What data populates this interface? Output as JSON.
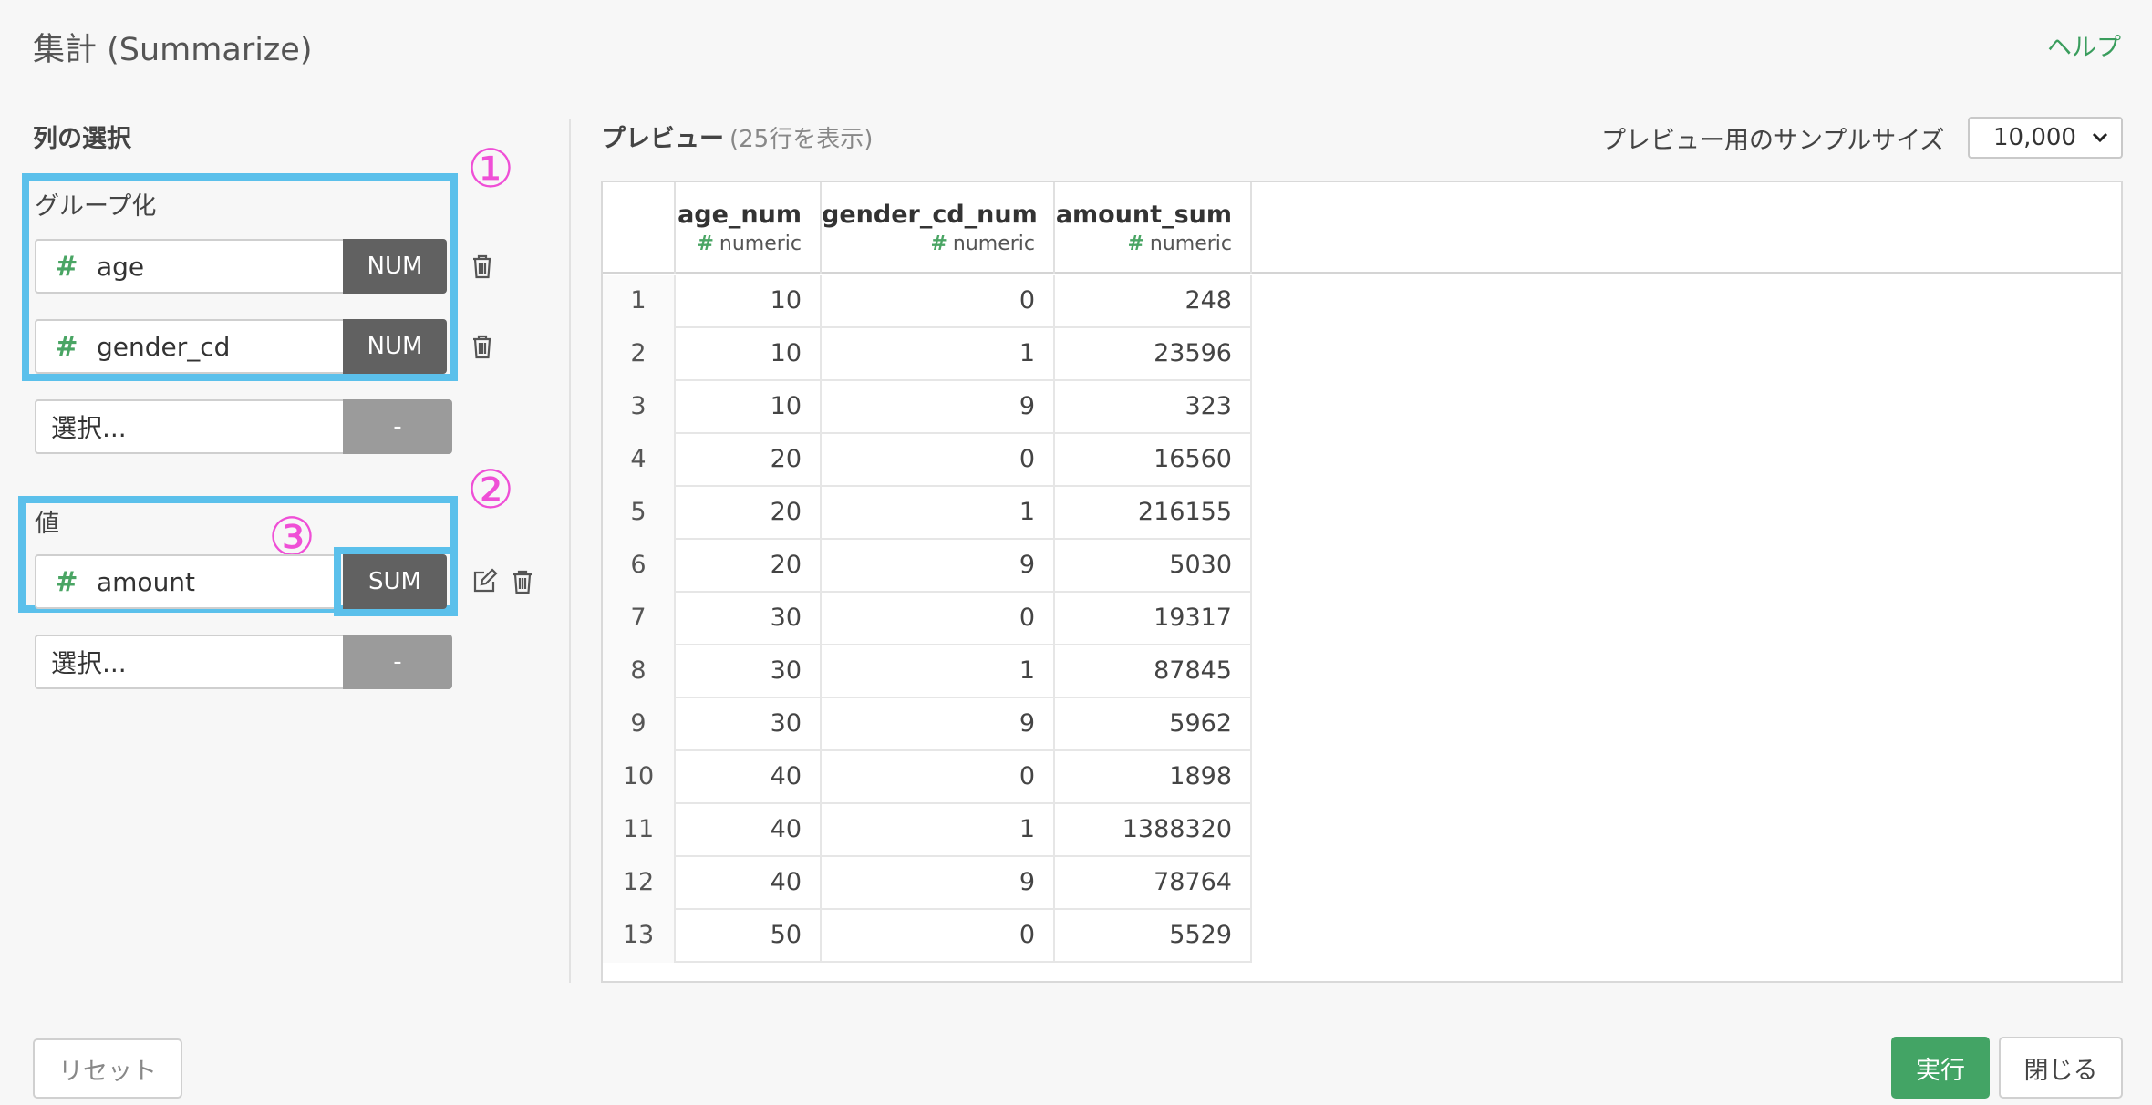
{
  "dialog": {
    "title": "集計 (Summarize)",
    "help_link": "ヘルプ"
  },
  "left_panel": {
    "heading": "列の選択",
    "group_by": {
      "label": "グループ化",
      "items": [
        {
          "icon": "hash-icon",
          "name": "age",
          "type": "NUM"
        },
        {
          "icon": "hash-icon",
          "name": "gender_cd",
          "type": "NUM"
        }
      ],
      "select_placeholder": "選択...",
      "select_type": "-"
    },
    "values": {
      "label": "値",
      "items": [
        {
          "icon": "hash-icon",
          "name": "amount",
          "agg": "SUM"
        }
      ],
      "select_placeholder": "選択...",
      "select_type": "-"
    },
    "annotations": [
      "①",
      "②",
      "③"
    ]
  },
  "preview": {
    "title": "プレビュー",
    "row_count_text": "(25行を表示)",
    "sample_size_label": "プレビュー用のサンプルサイズ",
    "sample_size_value": "10,000",
    "columns": [
      {
        "name": "age_num",
        "type": "numeric"
      },
      {
        "name": "gender_cd_num",
        "type": "numeric"
      },
      {
        "name": "amount_sum",
        "type": "numeric"
      }
    ],
    "type_icon": "#",
    "rows": [
      [
        "1",
        "10",
        "0",
        "248"
      ],
      [
        "2",
        "10",
        "1",
        "23596"
      ],
      [
        "3",
        "10",
        "9",
        "323"
      ],
      [
        "4",
        "20",
        "0",
        "16560"
      ],
      [
        "5",
        "20",
        "1",
        "216155"
      ],
      [
        "6",
        "20",
        "9",
        "5030"
      ],
      [
        "7",
        "30",
        "0",
        "19317"
      ],
      [
        "8",
        "30",
        "1",
        "87845"
      ],
      [
        "9",
        "30",
        "9",
        "5962"
      ],
      [
        "10",
        "40",
        "0",
        "1898"
      ],
      [
        "11",
        "40",
        "1",
        "1388320"
      ],
      [
        "12",
        "40",
        "9",
        "78764"
      ],
      [
        "13",
        "50",
        "0",
        "5529"
      ]
    ]
  },
  "footer": {
    "reset": "リセット",
    "run": "実行",
    "close": "閉じる"
  },
  "colors": {
    "accent_green": "#43a465",
    "highlight_blue": "#5bc0eb",
    "annotation_magenta": "#ef4fd6"
  }
}
